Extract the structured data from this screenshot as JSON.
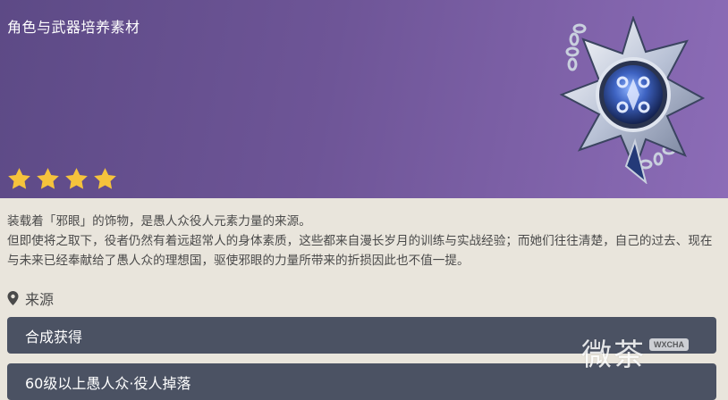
{
  "header": {
    "category": "角色与武器培养素材",
    "rarity": 4,
    "star_color": "#f5c33c",
    "banner_color_start": "#5d4a86",
    "banner_color_end": "#8c6cb7"
  },
  "item": {
    "icon": "vision-pendant-icon",
    "description_lines": [
      "装载着「邪眼」的饰物，是愚人众役人元素力量的来源。",
      "但即使将之取下，役者仍然有着远超常人的身体素质，这些都来自漫长岁月的训练与实战经验；而她们往往清楚，自己的过去、现在与未来已经奉献给了愚人众的理想国，驱使邪眼的力量所带来的折损因此也不值一提。"
    ]
  },
  "source": {
    "label": "来源",
    "icon": "location-pin-icon",
    "entries": [
      "合成获得",
      "60级以上愚人众·役人掉落"
    ]
  },
  "watermark": {
    "text": "微茶",
    "badge": "WXCHA"
  }
}
